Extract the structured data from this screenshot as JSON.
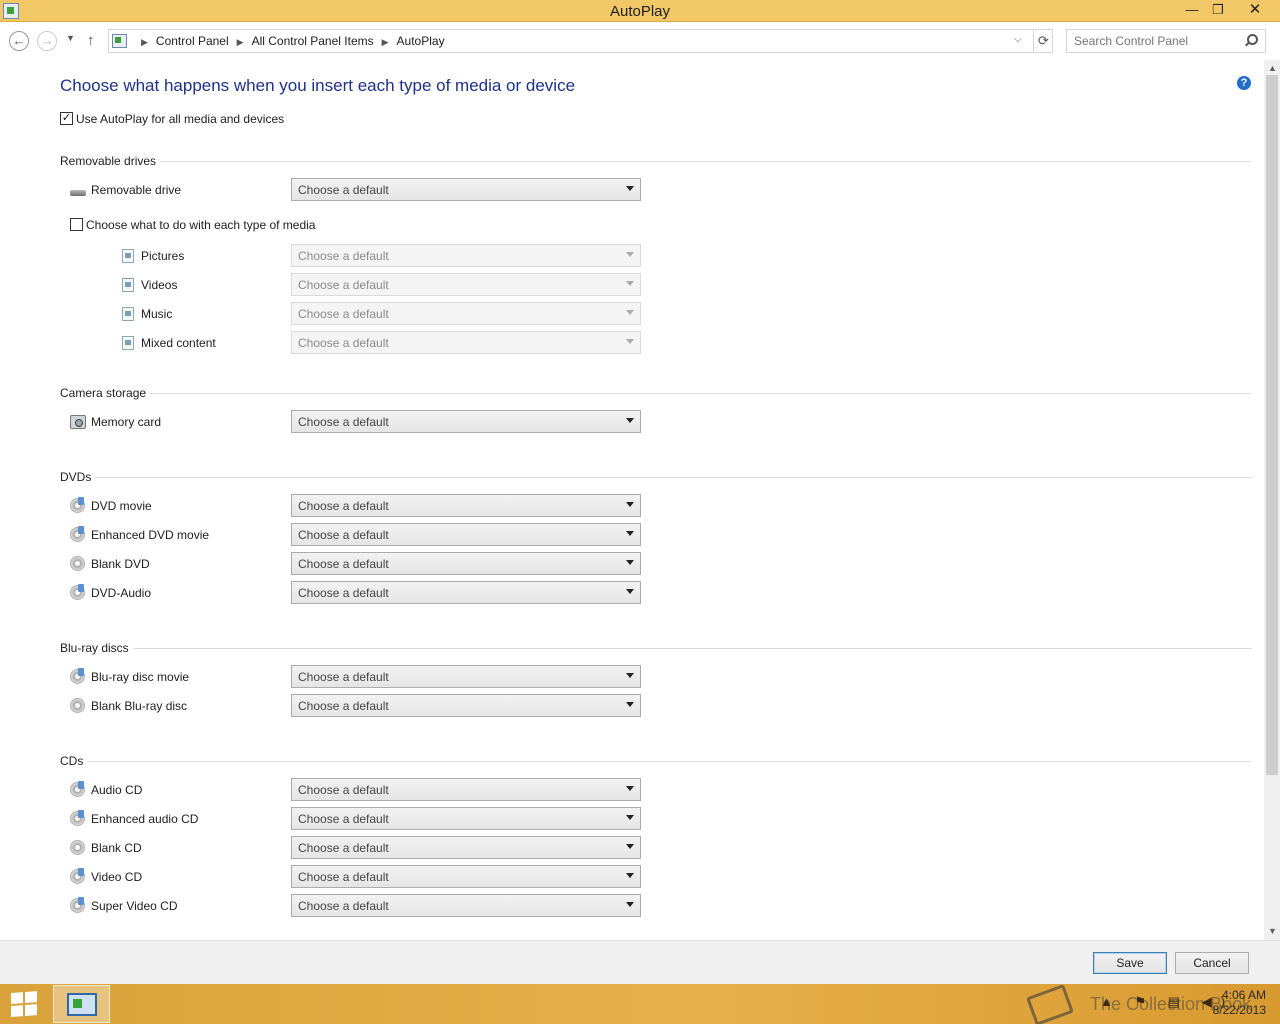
{
  "window": {
    "title": "AutoPlay",
    "minimize": "—",
    "maximize": "❐",
    "close": "✕"
  },
  "nav": {
    "back": "←",
    "forward": "→",
    "recent": "▼",
    "up": "↑",
    "breadcrumbs": [
      "Control Panel",
      "All Control Panel Items",
      "AutoPlay"
    ],
    "breadcrumb_sep": "▶",
    "address_dropdown": "⌵",
    "refresh": "⟳",
    "search_placeholder": "Search Control Panel"
  },
  "header": {
    "title": "Choose what happens when you insert each type of media or device",
    "help": "?"
  },
  "use_autoplay": {
    "label": "Use AutoPlay for all media and devices",
    "checked": true,
    "mark": "✓"
  },
  "default_text": "Choose a default",
  "sections": {
    "removable": {
      "title": "Removable drives",
      "removable_drive": "Removable drive",
      "choose_each": {
        "label": "Choose what to do with each type of media",
        "checked": false
      },
      "pictures": "Pictures",
      "videos": "Videos",
      "music": "Music",
      "mixed": "Mixed content"
    },
    "camera": {
      "title": "Camera storage",
      "memory_card": "Memory card"
    },
    "dvds": {
      "title": "DVDs",
      "dvd_movie": "DVD movie",
      "enhanced_dvd_movie": "Enhanced DVD movie",
      "blank_dvd": "Blank DVD",
      "dvd_audio": "DVD-Audio"
    },
    "bluray": {
      "title": "Blu-ray discs",
      "bluray_movie": "Blu-ray disc movie",
      "blank_bluray": "Blank Blu-ray disc"
    },
    "cds": {
      "title": "CDs",
      "audio_cd": "Audio CD",
      "enhanced_audio_cd": "Enhanced audio CD",
      "blank_cd": "Blank CD",
      "video_cd": "Video CD",
      "super_video_cd": "Super Video CD"
    }
  },
  "scrollbar": {
    "up": "▲",
    "down": "▼"
  },
  "footer": {
    "save": "Save",
    "cancel": "Cancel"
  },
  "taskbar": {
    "tray_icons": "▲ ⚑ ▤ ◀)",
    "time": "4:06 AM",
    "date": "8/22/2013",
    "watermark": "The Collection Book"
  }
}
